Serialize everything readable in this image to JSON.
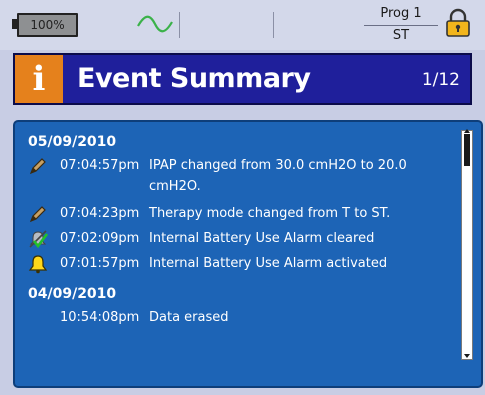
{
  "status": {
    "battery_label": "100%",
    "program_name": "Prog 1",
    "program_mode": "ST"
  },
  "header": {
    "icon_glyph": "i",
    "title": "Event Summary",
    "page_indicator": "1/12"
  },
  "events": [
    {
      "date": "05/09/2010",
      "entries": [
        {
          "icon": "pencil-icon",
          "time": "07:04:57pm",
          "message": "IPAP changed from 30.0 cmH2O to 20.0",
          "message_cont": "cmH2O."
        },
        {
          "icon": "pencil-icon",
          "time": "07:04:23pm",
          "message": "Therapy mode changed from T to ST."
        },
        {
          "icon": "alarm-cleared-icon",
          "time": "07:02:09pm",
          "message": "Internal Battery Use Alarm cleared"
        },
        {
          "icon": "alarm-bell-icon",
          "time": "07:01:57pm",
          "message": "Internal Battery Use Alarm activated"
        }
      ]
    },
    {
      "date": "04/09/2010",
      "entries": [
        {
          "icon": "",
          "time": "10:54:08pm",
          "message": "Data erased"
        }
      ]
    }
  ],
  "colors": {
    "accent_orange": "#e5811c",
    "title_bar": "#1f1f9b",
    "panel": "#1d64b6",
    "wave_green": "#3bb24a"
  }
}
